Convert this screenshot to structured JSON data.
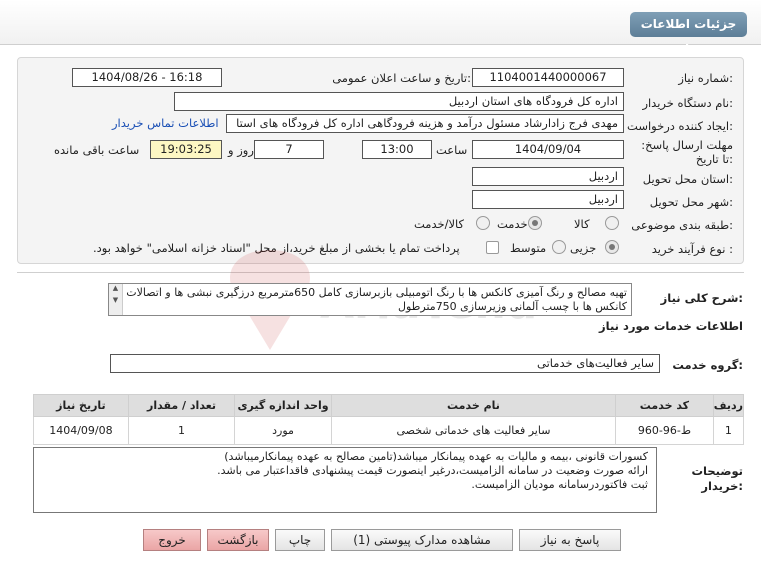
{
  "header": {
    "title": "جزئیات اطلاعات نیاز"
  },
  "form": {
    "need_number_label": "شماره نیاز:",
    "need_number": "1104001440000067",
    "announce_label": "تاریخ و ساعت اعلان عمومی:",
    "announce_value": "1404/08/26 - 16:18",
    "buyer_org_label": "نام دستگاه خریدار:",
    "buyer_org": "اداره کل فرودگاه های استان اردبیل",
    "creator_label": "ایجاد کننده درخواست:",
    "creator": "مهدی فرج زادارشاد مسئول درآمد و هزینه فرودگاهی اداره کل فرودگاه های استا",
    "contact_link": "اطلاعات تماس خریدار",
    "deadline_label": "مهلت ارسال پاسخ: تا تاریخ:",
    "deadline_date": "1404/09/04",
    "time_label": "ساعت",
    "deadline_time": "13:00",
    "days_value": "7",
    "days_label": "روز و",
    "remaining_time": "19:03:25",
    "remaining_label": "ساعت باقی مانده",
    "province_label": "استان محل تحویل:",
    "province": "اردبیل",
    "city_label": "شهر محل تحویل:",
    "city": "اردبیل",
    "category_label": "طبقه بندی موضوعی:",
    "category_options": [
      "کالا",
      "خدمت",
      "کالا/خدمت"
    ],
    "category_selected": "خدمت",
    "process_label": "نوع فرآیند خرید :",
    "process_options": [
      "جزیی",
      "متوسط"
    ],
    "process_selected": "جزیی",
    "payment_note": "پرداخت تمام یا بخشی از مبلغ خرید،از محل \"اسناد خزانه اسلامی\" خواهد بود."
  },
  "summary": {
    "label": "شرح کلی نیاز:",
    "text": "تهیه مصالح و رنگ آمیزی کانکس ها با رنگ اتومبیلی بازبرسازی کامل 650مترمربع درزگیری نبشی ها و اتصالات کانکس ها با چسب آلمانی وزیرسازی 750مترطول"
  },
  "services": {
    "section_title": "اطلاعات خدمات مورد نیاز",
    "group_label": "گروه خدمت:",
    "group_value": "سایر فعالیت‌های خدماتی",
    "columns": [
      "ردیف",
      "کد خدمت",
      "نام خدمت",
      "واحد اندازه گیری",
      "تعداد / مقدار",
      "تاریخ نیاز"
    ],
    "rows": [
      {
        "row": "1",
        "code": "ط-96-960",
        "name": "سایر فعالیت های خدماتی شخصی",
        "unit": "مورد",
        "qty": "1",
        "date": "1404/09/08"
      }
    ]
  },
  "notes": {
    "label": "توضیحات خریدار:",
    "lines": [
      "کسورات قانونی ،بیمه و مالیات به عهده پیمانکار میباشد(تامین مصالح به عهده پیمانکارمیباشد)",
      "ارائه صورت وضعیت در سامانه الزامیست،درغیر اینصورت قیمت پیشنهادی فاقداعتبار می باشد.",
      "ثبت فاکتوردرسامانه مودیان الزامیست."
    ]
  },
  "buttons": {
    "reply": "پاسخ به نیاز",
    "view_docs": "مشاهده مدارک پیوستی (1)",
    "print": "چاپ",
    "back": "بازگشت",
    "exit": "خروج"
  },
  "watermark_text": "AriaTender.net"
}
